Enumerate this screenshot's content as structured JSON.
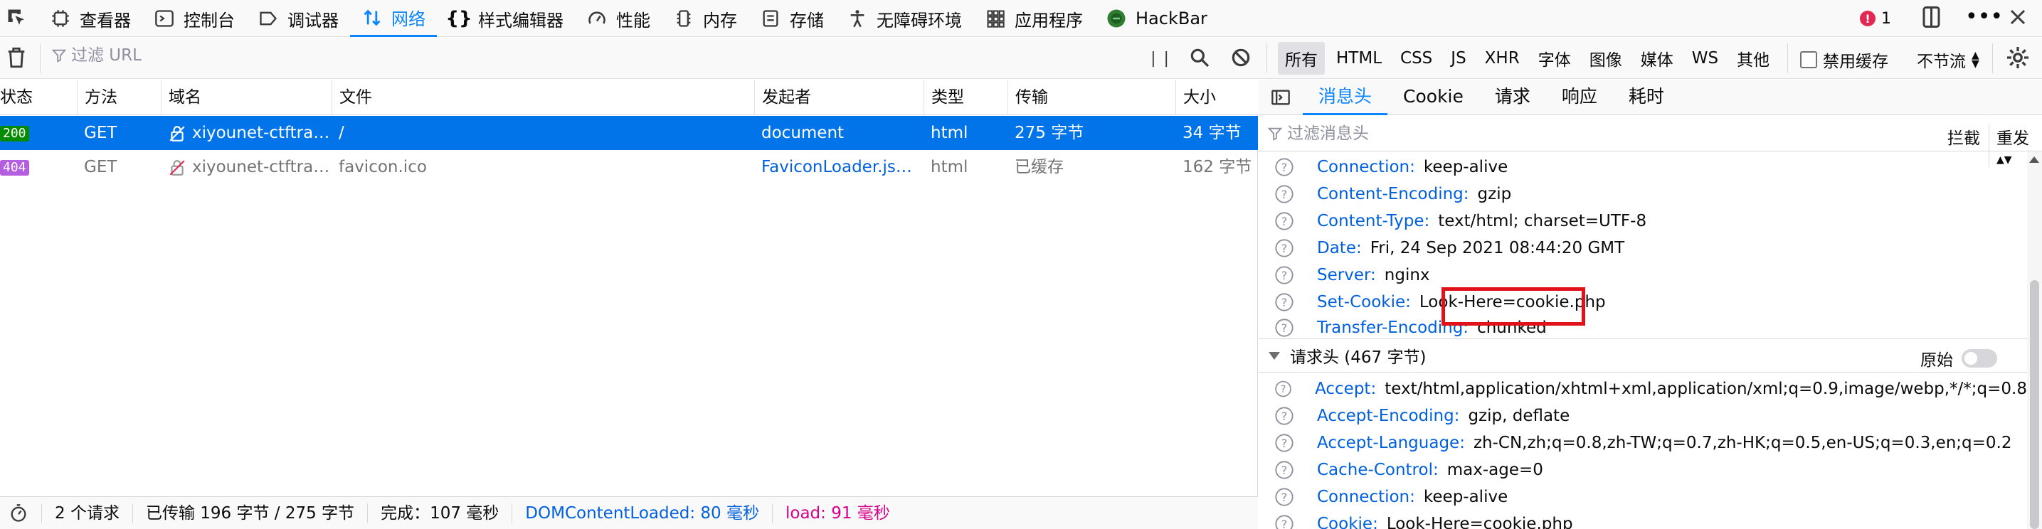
{
  "toolbar": {
    "tabs": [
      {
        "label": "查看器",
        "icon": "inspector-icon"
      },
      {
        "label": "控制台",
        "icon": "console-icon"
      },
      {
        "label": "调试器",
        "icon": "debugger-icon"
      },
      {
        "label": "网络",
        "icon": "network-icon",
        "active": true
      },
      {
        "label": "样式编辑器",
        "icon": "style-editor-icon"
      },
      {
        "label": "性能",
        "icon": "performance-icon"
      },
      {
        "label": "内存",
        "icon": "memory-icon"
      },
      {
        "label": "存储",
        "icon": "storage-icon"
      },
      {
        "label": "无障碍环境",
        "icon": "accessibility-icon"
      },
      {
        "label": "应用程序",
        "icon": "application-icon"
      },
      {
        "label": "HackBar",
        "icon": "hackbar-icon"
      }
    ],
    "error_count": "1"
  },
  "filterbar": {
    "url_placeholder": "过滤 URL",
    "pause_glyph": "| |",
    "type_filters": [
      "所有",
      "HTML",
      "CSS",
      "JS",
      "XHR",
      "字体",
      "图像",
      "媒体",
      "WS",
      "其他"
    ],
    "active_filter": "所有",
    "disable_cache": "禁用缓存",
    "throttling": "不节流"
  },
  "table": {
    "columns": [
      "状态",
      "方法",
      "域名",
      "文件",
      "发起者",
      "类型",
      "传输",
      "大小"
    ],
    "rows": [
      {
        "status": "200",
        "method": "GET",
        "domain": "xiyounet-ctftrai...",
        "file": "/",
        "initiator": "document",
        "type": "html",
        "transferred": "275 字节",
        "size": "34 字节"
      },
      {
        "status": "404",
        "method": "GET",
        "domain": "xiyounet-ctftrai...",
        "file": "favicon.ico",
        "initiator": "FaviconLoader.jsm...",
        "type": "html",
        "transferred": "已缓存",
        "size": "162 字节"
      }
    ]
  },
  "status": {
    "requests": "2 个请求",
    "transferred": "已传输 196 字节 / 275 字节",
    "finish": "完成：107 毫秒",
    "dom_content_loaded": "DOMContentLoaded: 80 毫秒",
    "load": "load: 91 毫秒"
  },
  "colors": {
    "accent": "#0a84ff",
    "status_200": "#058b00",
    "status_404": "#b55ee0",
    "dcl": "#0060df",
    "load": "#d70088",
    "highlight": "#e0121a"
  },
  "side": {
    "tabs": [
      "消息头",
      "Cookie",
      "请求",
      "响应",
      "耗时"
    ],
    "active_tab": "消息头",
    "filter_placeholder": "过滤消息头",
    "block_label": "拦截",
    "resend_label": "重发",
    "response_headers": [
      {
        "name": "Connection:",
        "value": "keep-alive"
      },
      {
        "name": "Content-Encoding:",
        "value": "gzip"
      },
      {
        "name": "Content-Type:",
        "value": "text/html; charset=UTF-8"
      },
      {
        "name": "Date:",
        "value": "Fri, 24 Sep 2021 08:44:20 GMT"
      },
      {
        "name": "Server:",
        "value": "nginx"
      },
      {
        "name": "Set-Cookie:",
        "value": "Look-Here=cookie.php"
      },
      {
        "name": "Transfer-Encoding:",
        "value": "chunked"
      }
    ],
    "request_section": "请求头 (467 字节)",
    "raw_label": "原始",
    "request_headers": [
      {
        "name": "Accept:",
        "value": "text/html,application/xhtml+xml,application/xml;q=0.9,image/webp,*/*;q=0.8"
      },
      {
        "name": "Accept-Encoding:",
        "value": "gzip, deflate"
      },
      {
        "name": "Accept-Language:",
        "value": "zh-CN,zh;q=0.8,zh-TW;q=0.7,zh-HK;q=0.5,en-US;q=0.3,en;q=0.2"
      },
      {
        "name": "Cache-Control:",
        "value": "max-age=0"
      },
      {
        "name": "Connection:",
        "value": "keep-alive"
      },
      {
        "name": "Cookie:",
        "value": "Look-Here=cookie.php"
      }
    ]
  }
}
